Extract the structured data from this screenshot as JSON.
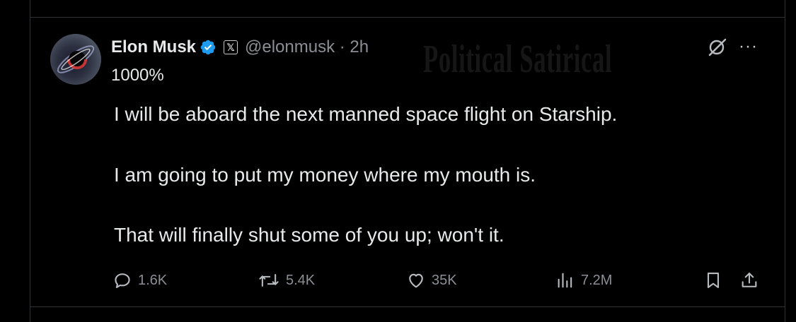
{
  "watermark": "Political Satirical",
  "tweet": {
    "author_name": "Elon Musk",
    "verified_icon": "verified-badge-icon",
    "affiliation_icon": "x-logo-icon",
    "affiliation_label": "𝕏",
    "handle_time": "@elonmusk · 2h",
    "quote": "1000%",
    "lines": [
      "I will be aboard the next manned space flight on Starship.",
      "I am going to put my money where my mouth is.",
      "That will finally shut some of you up; won't it."
    ],
    "more_label": "···",
    "actions": {
      "replies": "1.6K",
      "reposts": "5.4K",
      "likes": "35K",
      "views": "7.2M"
    }
  },
  "colors": {
    "background": "#000000",
    "text": "#e7e9ea",
    "muted": "#8b8f94",
    "verified": "#1d9bf0",
    "border": "#2f3336"
  }
}
